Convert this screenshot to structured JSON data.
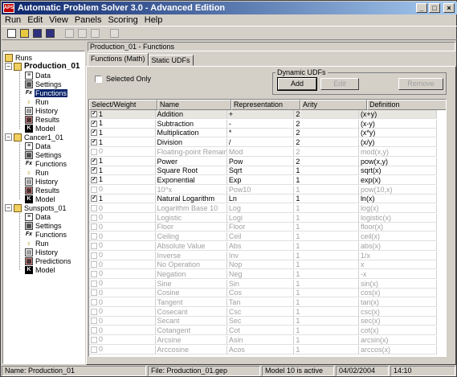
{
  "window": {
    "icon_text": "APS",
    "title": "Automatic Problem Solver 3.0 - Advanced Edition",
    "minimize": "_",
    "maximize": "□",
    "close": "×"
  },
  "menu": [
    "Run",
    "Edit",
    "View",
    "Panels",
    "Scoring",
    "Help"
  ],
  "toolbar": {
    "buttons": [
      "new-file-icon",
      "open-folder-icon",
      "save-icon",
      "save-all-icon",
      "cut-icon",
      "grid-icon",
      "table-icon",
      "print-icon"
    ]
  },
  "tree": {
    "root": "Runs",
    "projects": [
      {
        "name": "Production_01",
        "children": [
          "Data",
          "Settings",
          "Functions",
          "Run",
          "History",
          "Results",
          "Model"
        ]
      },
      {
        "name": "Cancer1_01",
        "children": [
          "Data",
          "Settings",
          "Functions",
          "Run",
          "History",
          "Results",
          "Model"
        ]
      },
      {
        "name": "Sunspots_01",
        "children": [
          "Data",
          "Settings",
          "Functions",
          "Run",
          "History",
          "Predictions",
          "Model"
        ]
      }
    ],
    "selected": "Functions"
  },
  "main": {
    "header": "Production_01 - Functions",
    "tabs": [
      "Functions (Math)",
      "Static UDFs"
    ],
    "selected_only_label": "Selected Only",
    "dynamic_udfs_label": "Dynamic UDFs",
    "add_label": "Add",
    "edit_label": "Edit",
    "remove_label": "Remove"
  },
  "table": {
    "columns": [
      "Select/Weight",
      "Name",
      "Representation",
      "Arity",
      "Definition"
    ],
    "rows": [
      {
        "checked": true,
        "weight": "1",
        "name": "Addition",
        "rep": "+",
        "arity": "2",
        "def": "(x+y)"
      },
      {
        "checked": true,
        "weight": "1",
        "name": "Subtraction",
        "rep": "-",
        "arity": "2",
        "def": "(x-y)"
      },
      {
        "checked": true,
        "weight": "1",
        "name": "Multiplication",
        "rep": "*",
        "arity": "2",
        "def": "(x*y)"
      },
      {
        "checked": true,
        "weight": "1",
        "name": "Division",
        "rep": "/",
        "arity": "2",
        "def": "(x/y)"
      },
      {
        "checked": false,
        "weight": "0",
        "name": "Floating-point Remainder",
        "rep": "Mod",
        "arity": "2",
        "def": "mod(x,y)"
      },
      {
        "checked": true,
        "weight": "1",
        "name": "Power",
        "rep": "Pow",
        "arity": "2",
        "def": "pow(x,y)"
      },
      {
        "checked": true,
        "weight": "1",
        "name": "Square Root",
        "rep": "Sqrt",
        "arity": "1",
        "def": "sqrt(x)"
      },
      {
        "checked": true,
        "weight": "1",
        "name": "Exponential",
        "rep": "Exp",
        "arity": "1",
        "def": "exp(x)"
      },
      {
        "checked": false,
        "weight": "0",
        "name": "10^x",
        "rep": "Pow10",
        "arity": "1",
        "def": "pow(10,x)"
      },
      {
        "checked": true,
        "weight": "1",
        "name": "Natural Logarithm",
        "rep": "Ln",
        "arity": "1",
        "def": "ln(x)"
      },
      {
        "checked": false,
        "weight": "0",
        "name": "Logarithm Base 10",
        "rep": "Log",
        "arity": "1",
        "def": "log(x)"
      },
      {
        "checked": false,
        "weight": "0",
        "name": "Logistic",
        "rep": "Logi",
        "arity": "1",
        "def": "logistic(x)"
      },
      {
        "checked": false,
        "weight": "0",
        "name": "Floor",
        "rep": "Floor",
        "arity": "1",
        "def": "floor(x)"
      },
      {
        "checked": false,
        "weight": "0",
        "name": "Ceiling",
        "rep": "Ceil",
        "arity": "1",
        "def": "ceil(x)"
      },
      {
        "checked": false,
        "weight": "0",
        "name": "Absolute Value",
        "rep": "Abs",
        "arity": "1",
        "def": "abs(x)"
      },
      {
        "checked": false,
        "weight": "0",
        "name": "Inverse",
        "rep": "Inv",
        "arity": "1",
        "def": "1/x"
      },
      {
        "checked": false,
        "weight": "0",
        "name": "No Operation",
        "rep": "Nop",
        "arity": "1",
        "def": "x"
      },
      {
        "checked": false,
        "weight": "0",
        "name": "Negation",
        "rep": "Neg",
        "arity": "1",
        "def": "-x"
      },
      {
        "checked": false,
        "weight": "0",
        "name": "Sine",
        "rep": "Sin",
        "arity": "1",
        "def": "sin(x)"
      },
      {
        "checked": false,
        "weight": "0",
        "name": "Cosine",
        "rep": "Cos",
        "arity": "1",
        "def": "cos(x)"
      },
      {
        "checked": false,
        "weight": "0",
        "name": "Tangent",
        "rep": "Tan",
        "arity": "1",
        "def": "tan(x)"
      },
      {
        "checked": false,
        "weight": "0",
        "name": "Cosecant",
        "rep": "Csc",
        "arity": "1",
        "def": "csc(x)"
      },
      {
        "checked": false,
        "weight": "0",
        "name": "Secant",
        "rep": "Sec",
        "arity": "1",
        "def": "sec(x)"
      },
      {
        "checked": false,
        "weight": "0",
        "name": "Cotangent",
        "rep": "Cot",
        "arity": "1",
        "def": "cot(x)"
      },
      {
        "checked": false,
        "weight": "0",
        "name": "Arcsine",
        "rep": "Asin",
        "arity": "1",
        "def": "arcsin(x)"
      },
      {
        "checked": false,
        "weight": "0",
        "name": "Arccosine",
        "rep": "Acos",
        "arity": "1",
        "def": "arccos(x)"
      }
    ]
  },
  "status": {
    "name": "Name: Production_01",
    "file": "File: Production_01.gep",
    "model": "Model 10 is active",
    "date": "04/02/2004",
    "time": "14:10"
  }
}
